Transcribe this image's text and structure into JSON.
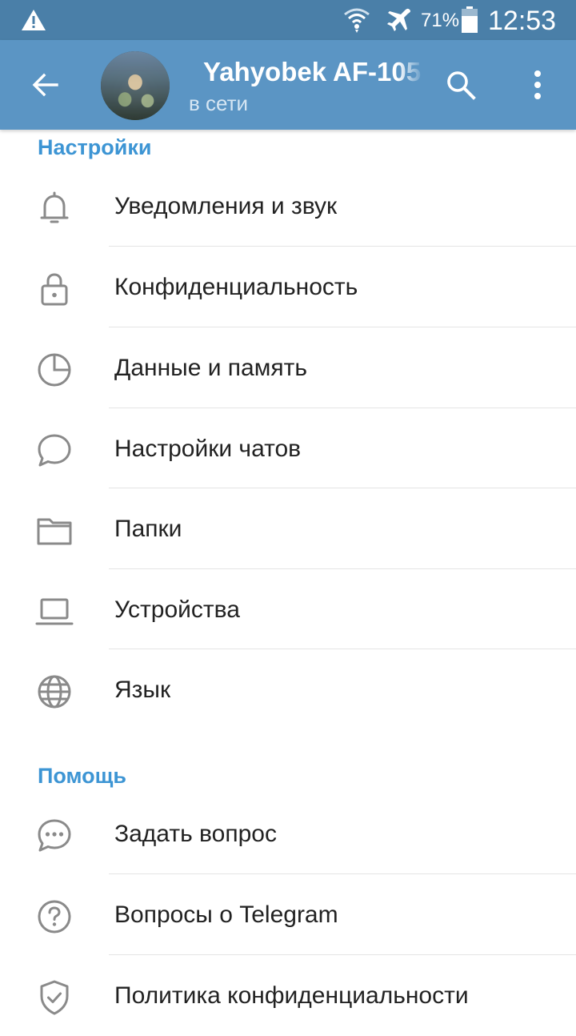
{
  "status_bar": {
    "battery_percent": "71%",
    "time": "12:53",
    "icons": [
      "warning-icon",
      "wifi-icon",
      "airplane-icon",
      "battery-icon"
    ]
  },
  "header": {
    "title": "Yahyobek AF-105",
    "subtitle": "в сети",
    "color": "#5b95c4",
    "icons": [
      "back-arrow-icon",
      "search-icon",
      "more-vert-icon"
    ]
  },
  "sections": [
    {
      "title": "Настройки",
      "items": [
        {
          "label": "Уведомления и звук",
          "icon": "bell-icon"
        },
        {
          "label": "Конфиденциальность",
          "icon": "lock-icon"
        },
        {
          "label": "Данные и память",
          "icon": "pie-chart-icon"
        },
        {
          "label": "Настройки чатов",
          "icon": "chat-bubble-icon"
        },
        {
          "label": "Папки",
          "icon": "folder-icon"
        },
        {
          "label": "Устройства",
          "icon": "laptop-icon"
        },
        {
          "label": "Язык",
          "icon": "globe-icon"
        }
      ]
    },
    {
      "title": "Помощь",
      "items": [
        {
          "label": "Задать вопрос",
          "icon": "chat-dots-icon"
        },
        {
          "label": "Вопросы о Telegram",
          "icon": "question-icon"
        },
        {
          "label": "Политика конфиденциальности",
          "icon": "shield-check-icon"
        }
      ]
    }
  ],
  "colors": {
    "accent": "#3d95d4",
    "status_bar": "#4a7fa8",
    "icon_gray": "#8a8a8a",
    "divider": "#e4e4e4"
  }
}
